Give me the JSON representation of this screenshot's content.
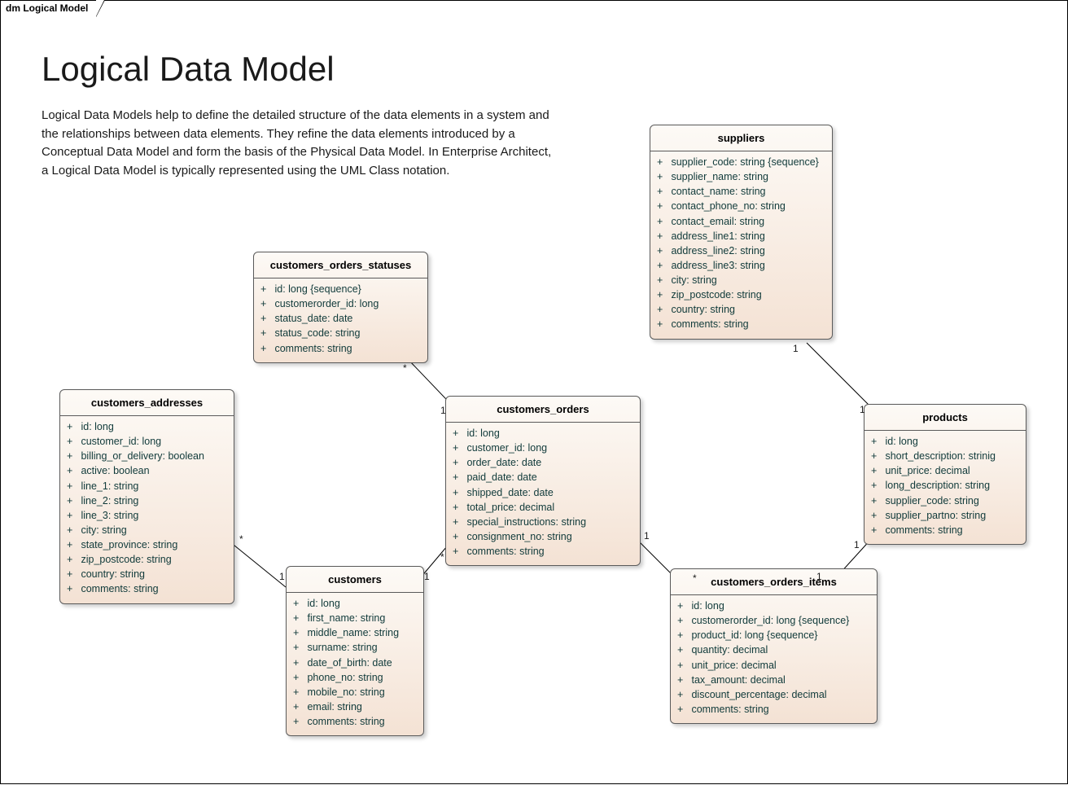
{
  "tab_label": "dm Logical Model",
  "title": "Logical Data Model",
  "description": "Logical Data Models help to define the detailed structure of the data elements in a system and the relationships between data elements. They refine the data elements introduced by a Conceptual Data Model and form the basis of the Physical Data Model. In Enterprise Architect, a Logical Data Model is typically represented using the UML Class notation.",
  "entities": {
    "customers_orders_statuses": {
      "name": "customers_orders_statuses",
      "attrs": [
        "id: long {sequence}",
        "customerorder_id: long",
        "status_date: date",
        "status_code: string",
        "comments: string"
      ]
    },
    "customers_addresses": {
      "name": "customers_addresses",
      "attrs": [
        "id: long",
        "customer_id: long",
        "billing_or_delivery: boolean",
        "active: boolean",
        "line_1: string",
        "line_2: string",
        "line_3: string",
        "city: string",
        "state_province: string",
        "zip_postcode: string",
        "country: string",
        "comments: string"
      ]
    },
    "customers_orders": {
      "name": "customers_orders",
      "attrs": [
        "id: long",
        "customer_id: long",
        "order_date: date",
        "paid_date: date",
        "shipped_date: date",
        "total_price: decimal",
        "special_instructions: string",
        "consignment_no: string",
        "comments: string"
      ]
    },
    "customers": {
      "name": "customers",
      "attrs": [
        "id: long",
        "first_name: string",
        "middle_name: string",
        "surname: string",
        "date_of_birth: date",
        "phone_no: string",
        "mobile_no: string",
        "email: string",
        "comments: string"
      ]
    },
    "suppliers": {
      "name": "suppliers",
      "attrs": [
        "supplier_code: string {sequence}",
        "supplier_name: string",
        "contact_name: string",
        "contact_phone_no: string",
        "contact_email: string",
        "address_line1: string",
        "address_line2: string",
        "address_line3: string",
        "city: string",
        "zip_postcode: string",
        "country: string",
        "comments: string"
      ]
    },
    "products": {
      "name": "products",
      "attrs": [
        "id: long",
        "short_description: strinig",
        "unit_price: decimal",
        "long_description: string",
        "supplier_code: string",
        "supplier_partno: string",
        "comments: string"
      ]
    },
    "customers_orders_items": {
      "name": "customers_orders_items",
      "attrs": [
        "id: long",
        "customerorder_id: long {sequence}",
        "product_id: long {sequence}",
        "quantity: decimal",
        "unit_price: decimal",
        "tax_amount: decimal",
        "discount_percentage: decimal",
        "comments: string"
      ]
    }
  },
  "multiplicities": {
    "cos_star": "*",
    "co_one_top": "1",
    "ca_star": "*",
    "cust_one_left": "1",
    "co_star_bottom": "*",
    "cust_one_right": "1",
    "co_one_right": "1",
    "coi_star": "*",
    "coi_one": "1",
    "prod_one_bottom": "1",
    "prod_one_top": "1",
    "supp_one": "1"
  }
}
